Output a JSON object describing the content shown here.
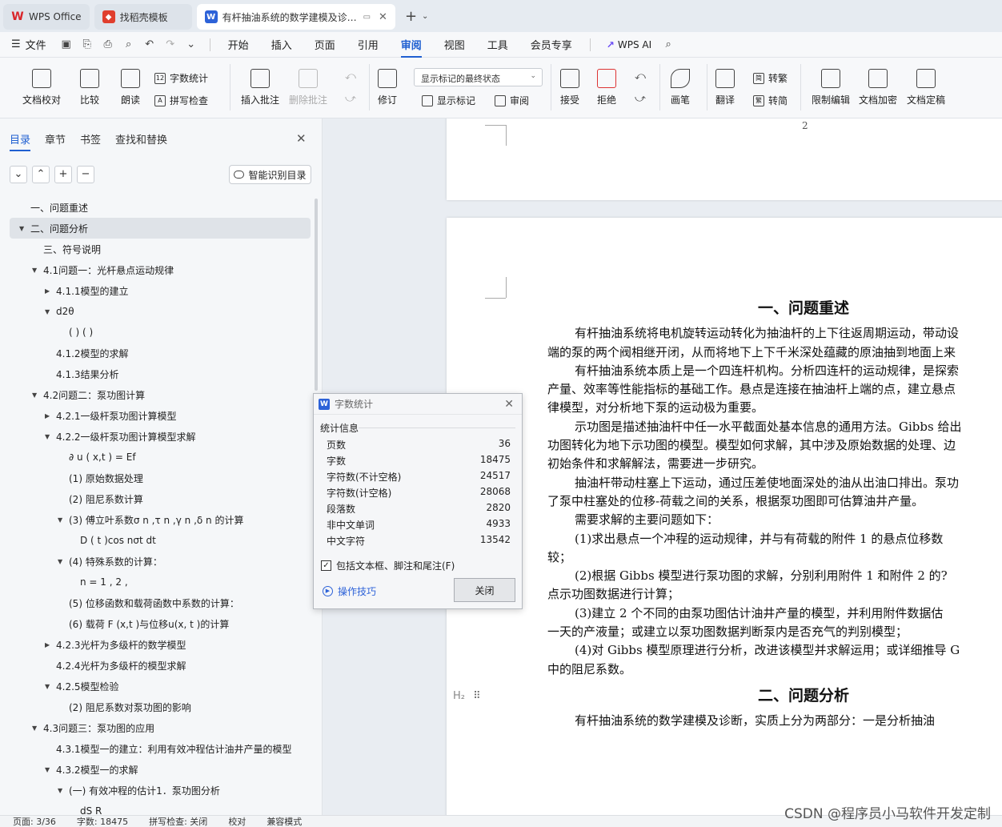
{
  "tabs": [
    {
      "label": "WPS Office",
      "color": "#d9252a"
    },
    {
      "label": "找稻壳模板",
      "color": "#e03e2d"
    },
    {
      "label": "有杆抽油系统的数学建模及诊…",
      "color": "#2d62d8"
    }
  ],
  "menu": {
    "file": "文件",
    "items": [
      "开始",
      "插入",
      "页面",
      "引用",
      "审阅",
      "视图",
      "工具",
      "会员专享"
    ],
    "active": "审阅",
    "ai": "WPS AI"
  },
  "ribbon": {
    "doc_check": "文档校对",
    "compare": "比较",
    "read_aloud": "朗读",
    "word_count": "字数统计",
    "spell_check": "拼写检查",
    "insert_comment": "插入批注",
    "delete_comment": "删除批注",
    "revise": "修订",
    "markup_state": "显示标记的最终状态",
    "show_markup": "显示标记",
    "review": "审阅",
    "accept": "接受",
    "reject": "拒绝",
    "pen": "画笔",
    "translate": "翻译",
    "to_trad": "转繁",
    "to_simp": "转简",
    "restrict_edit": "限制编辑",
    "encrypt": "文档加密",
    "finalize": "文档定稿"
  },
  "sidebar": {
    "tabs": [
      "目录",
      "章节",
      "书签",
      "查找和替换"
    ],
    "active_tab": "目录",
    "smart_button": "智能识别目录",
    "toc": [
      {
        "text": "一、问题重述",
        "level": 0,
        "arrow": ""
      },
      {
        "text": "二、问题分析",
        "level": 0,
        "arrow": "down",
        "selected": true
      },
      {
        "text": "三、符号说明",
        "level": 1,
        "arrow": ""
      },
      {
        "text": "4.1问题一：光杆悬点运动规律",
        "level": 1,
        "arrow": "down"
      },
      {
        "text": "4.1.1模型的建立",
        "level": 2,
        "arrow": "right"
      },
      {
        "text": "d2θ",
        "level": 2,
        "arrow": "down"
      },
      {
        "text": "( ) ( )",
        "level": 3,
        "arrow": ""
      },
      {
        "text": "4.1.2模型的求解",
        "level": 2,
        "arrow": ""
      },
      {
        "text": "4.1.3结果分析",
        "level": 2,
        "arrow": ""
      },
      {
        "text": "4.2问题二：泵功图计算",
        "level": 1,
        "arrow": "down"
      },
      {
        "text": "4.2.1一级杆泵功图计算模型",
        "level": 2,
        "arrow": "right"
      },
      {
        "text": "4.2.2一级杆泵功图计算模型求解",
        "level": 2,
        "arrow": "down"
      },
      {
        "text": "∂ u ( x,t ) = Ef",
        "level": 3,
        "arrow": ""
      },
      {
        "text": "(1)  原始数据处理",
        "level": 3,
        "arrow": ""
      },
      {
        "text": "(2)  阻尼系数计算",
        "level": 3,
        "arrow": ""
      },
      {
        "text": "(3)  傅立叶系数σ n ,τ n ,γ n ,δ n 的计算",
        "level": 3,
        "arrow": "down"
      },
      {
        "text": "D ( t )cos nσt dt",
        "level": 4,
        "arrow": ""
      },
      {
        "text": "(4)  特殊系数的计算：",
        "level": 3,
        "arrow": "down"
      },
      {
        "text": "n = 1 , 2 ,",
        "level": 4,
        "arrow": ""
      },
      {
        "text": "(5)  位移函数和载荷函数中系数的计算：",
        "level": 3,
        "arrow": ""
      },
      {
        "text": "(6)  载荷 F (x,t )与位移u(x, t )的计算",
        "level": 3,
        "arrow": ""
      },
      {
        "text": "4.2.3光杆为多级杆的数学模型",
        "level": 2,
        "arrow": "right"
      },
      {
        "text": "4.2.4光杆为多级杆的模型求解",
        "level": 2,
        "arrow": ""
      },
      {
        "text": "4.2.5模型检验",
        "level": 2,
        "arrow": "down"
      },
      {
        "text": "(2)  阻尼系数对泵功图的影响",
        "level": 3,
        "arrow": ""
      },
      {
        "text": "4.3问题三：泵功图的应用",
        "level": 1,
        "arrow": "down"
      },
      {
        "text": "4.3.1模型一的建立：利用有效冲程估计油井产量的模型",
        "level": 2,
        "arrow": ""
      },
      {
        "text": "4.3.2模型一的求解",
        "level": 2,
        "arrow": "down"
      },
      {
        "text": "(一)  有效冲程的估计1．泵功图分析",
        "level": 3,
        "arrow": "down"
      },
      {
        "text": "dS R",
        "level": 4,
        "arrow": ""
      }
    ]
  },
  "doc": {
    "page_number": "2",
    "heading1": "一、问题重述",
    "paragraphs": [
      {
        "text": "有杆抽油系统将电机旋转运动转化为抽油杆的上下往返周期运动，带动设",
        "indent": true
      },
      {
        "text": "端的泵的两个阀相继开闭，从而将地下上下千米深处蕴藏的原油抽到地面上来",
        "indent": false
      },
      {
        "text": "有杆抽油系统本质上是一个四连杆机构。分析四连杆的运动规律，是探索",
        "indent": true
      },
      {
        "text": "产量、效率等性能指标的基础工作。悬点是连接在抽油杆上端的点，建立悬点",
        "indent": false
      },
      {
        "text": "律模型，对分析地下泵的运动极为重要。",
        "indent": false
      },
      {
        "text": "示功图是描述抽油杆中任一水平截面处基本信息的通用方法。Gibbs 给出",
        "indent": true
      },
      {
        "text": "功图转化为地下示功图的模型。模型如何求解，其中涉及原始数据的处理、边",
        "indent": false
      },
      {
        "text": "初始条件和求解解法，需要进一步研究。",
        "indent": false
      },
      {
        "text": "抽油杆带动柱塞上下运动，通过压差使地面深处的油从出油口排出。泵功",
        "indent": true
      },
      {
        "text": "了泵中柱塞处的位移-荷载之间的关系，根据泵功图即可估算油井产量。",
        "indent": false
      },
      {
        "text": "需要求解的主要问题如下：",
        "indent": true
      },
      {
        "text": "(1)求出悬点一个冲程的运动规律，并与有荷载的附件 1 的悬点位移数",
        "indent": true
      },
      {
        "text": "较；",
        "indent": false
      },
      {
        "text": "(2)根据 Gibbs 模型进行泵功图的求解，分别利用附件 1 和附件 2 的?",
        "indent": true
      },
      {
        "text": "点示功图数据进行计算；",
        "indent": false
      },
      {
        "text": "(3)建立 2 个不同的由泵功图估计油井产量的模型，并利用附件数据估",
        "indent": true
      },
      {
        "text": "一天的产液量；或建立以泵功图数据判断泵内是否充气的判别模型；",
        "indent": false
      },
      {
        "text": "(4)对 Gibbs 模型原理进行分析，改进该模型并求解运用；或详细推导 G",
        "indent": true
      },
      {
        "text": "中的阻尼系数。",
        "indent": false
      }
    ],
    "heading2": "二、问题分析",
    "heading2_marker": "H₂",
    "paragraph_last": "有杆抽油系统的数学建模及诊断，实质上分为两部分：一是分析抽油"
  },
  "dialog": {
    "title": "字数统计",
    "section": "统计信息",
    "stats": [
      {
        "label": "页数",
        "value": "36"
      },
      {
        "label": "字数",
        "value": "18475"
      },
      {
        "label": "字符数(不计空格)",
        "value": "24517"
      },
      {
        "label": "字符数(计空格)",
        "value": "28068"
      },
      {
        "label": "段落数",
        "value": "2820"
      },
      {
        "label": "非中文单词",
        "value": "4933"
      },
      {
        "label": "中文字符",
        "value": "13542"
      }
    ],
    "checkbox_label": "包括文本框、脚注和尾注(F)",
    "checkbox_checked": true,
    "tips": "操作技巧",
    "close": "关闭"
  },
  "status": {
    "page": "页面: 3/36",
    "words": "字数: 18475",
    "spell": "拼写检查: 关闭",
    "proof": "校对",
    "compat": "兼容模式"
  },
  "watermark": "CSDN @程序员小马软件开发定制"
}
